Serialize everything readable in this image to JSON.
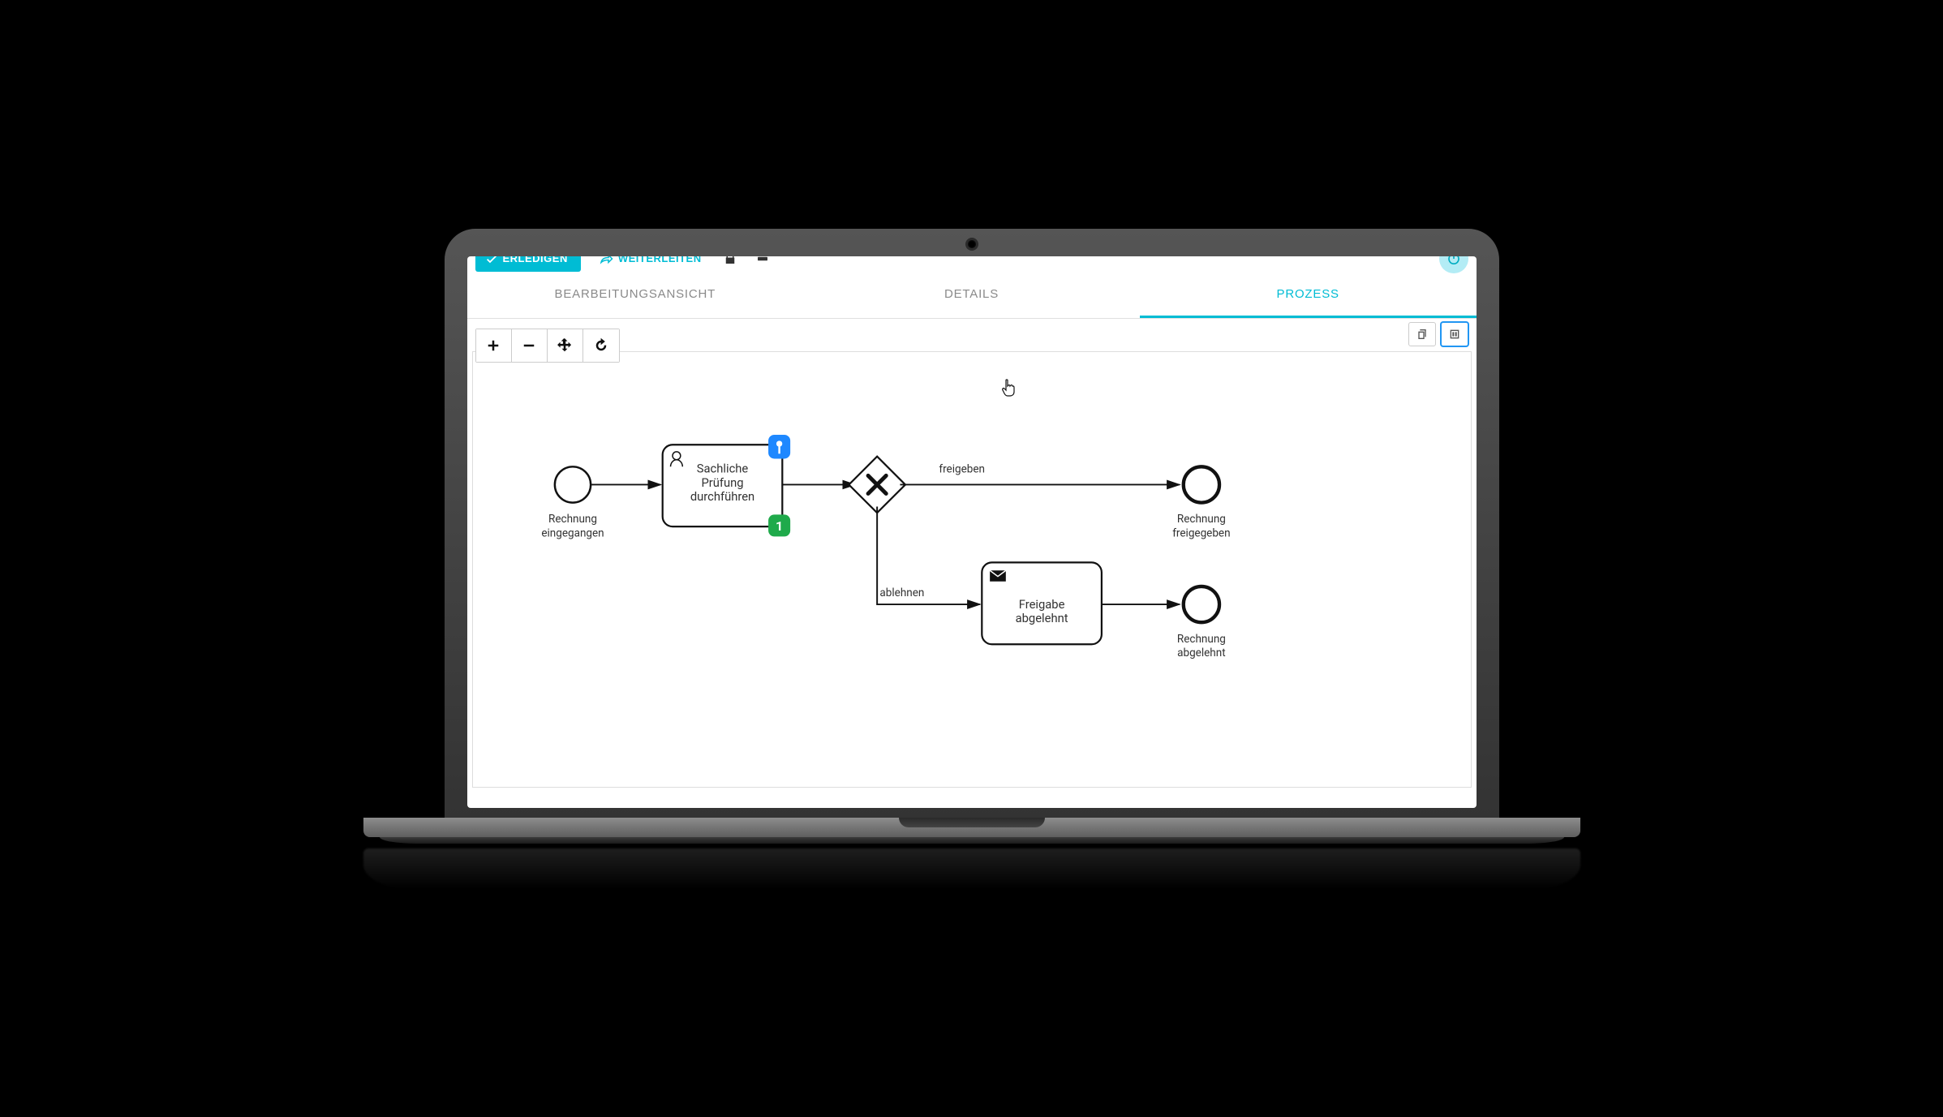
{
  "toolbar": {
    "complete_label": "ERLEDIGEN",
    "forward_label": "WEITERLEITEN"
  },
  "tabs": [
    {
      "label": "BEARBEITUNGSANSICHT",
      "active": false
    },
    {
      "label": "DETAILS",
      "active": false
    },
    {
      "label": "PROZESS",
      "active": true
    }
  ],
  "process": {
    "start_event": {
      "label_line1": "Rechnung",
      "label_line2": "eingegangen"
    },
    "task_current": {
      "line1": "Sachliche",
      "line2": "Prüfung",
      "line3": "durchführen",
      "badge_count": "1"
    },
    "gateway": {
      "type": "exclusive"
    },
    "flow_top_label": "freigeben",
    "flow_bottom_label": "ablehnen",
    "task_reject": {
      "line1": "Freigabe",
      "line2": "abgelehnt"
    },
    "end_event_top": {
      "label_line1": "Rechnung",
      "label_line2": "freigegeben"
    },
    "end_event_bottom": {
      "label_line1": "Rechnung",
      "label_line2": "abgelehnt"
    }
  },
  "colors": {
    "accent": "#00bcd4",
    "marker_blue": "#1e88ff",
    "marker_green": "#1faa4b"
  }
}
